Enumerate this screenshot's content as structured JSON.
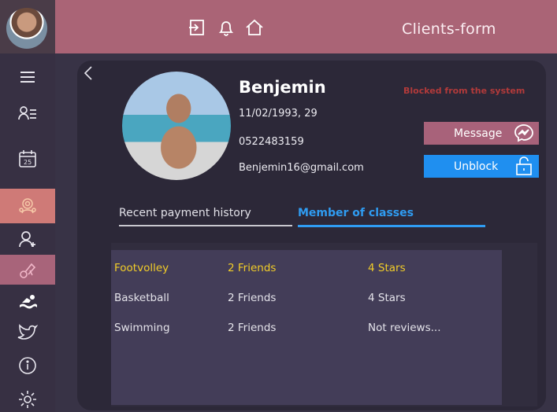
{
  "header": {
    "title": "Clients-form",
    "icons": [
      "logout-icon",
      "bell-icon",
      "home-icon"
    ]
  },
  "sidebar": {
    "items": [
      "menu-icon",
      "client-list-icon",
      "calendar-icon",
      "classes-icon",
      "add-user-icon",
      "exercise-icon",
      "swim-icon",
      "bird-icon",
      "info-icon",
      "settings-icon"
    ],
    "calendar_day": "25"
  },
  "profile": {
    "name": "Benjemin",
    "status": "Blocked from the system",
    "birth": "11/02/1993, 29",
    "phone": "0522483159",
    "email": "Benjemin16@gmail.com"
  },
  "actions": {
    "message_label": "Message",
    "unblock_label": "Unblock"
  },
  "tabs": {
    "history": "Recent payment history",
    "classes": "Member of classes",
    "active": "classes"
  },
  "classes": [
    {
      "name": "Footvolley",
      "friends": "2 Friends",
      "rating": "4 Stars"
    },
    {
      "name": "Basketball",
      "friends": "2 Friends",
      "rating": "4 Stars"
    },
    {
      "name": "Swimming",
      "friends": "2 Friends",
      "rating": "Not reviews..."
    }
  ],
  "colors": {
    "header": "#aa6476",
    "sidebar": "#373043",
    "accent_blue": "#2f9cf2",
    "selected_row": "#f2cd28",
    "blocked": "#b23a3a"
  }
}
